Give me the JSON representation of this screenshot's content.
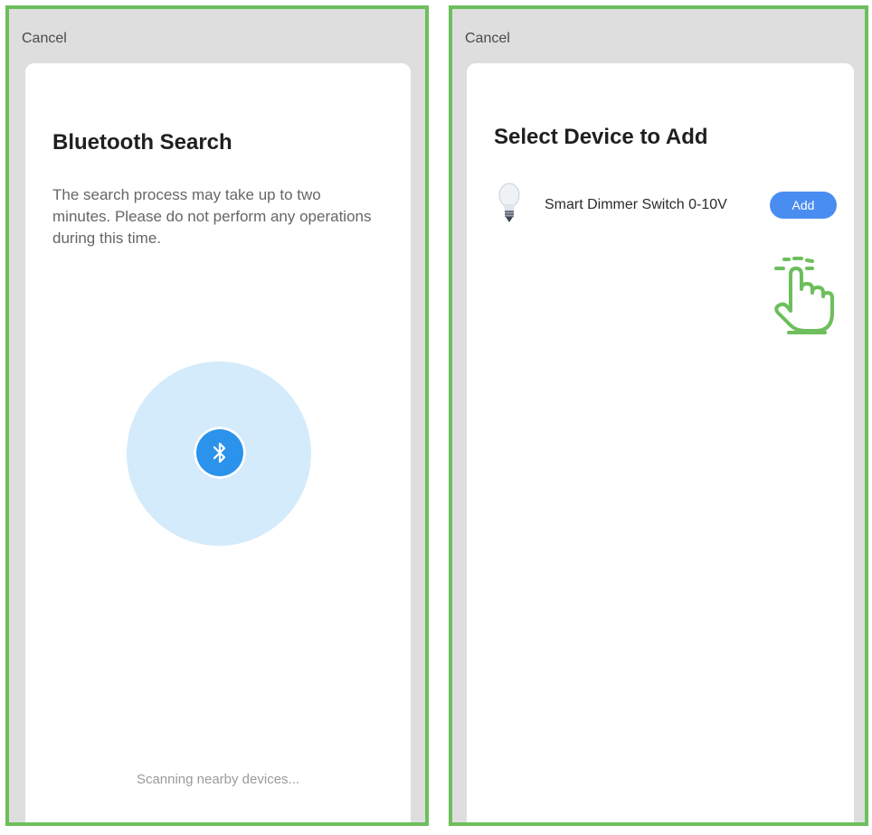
{
  "left_screen": {
    "cancel_label": "Cancel",
    "title": "Bluetooth Search",
    "description": "The search process may take up to two minutes. Please do not perform any operations during this time.",
    "status": "Scanning nearby devices...",
    "icon": "bluetooth-icon"
  },
  "right_screen": {
    "cancel_label": "Cancel",
    "title": "Select Device to Add",
    "devices": [
      {
        "name": "Smart Dimmer Switch 0-10V",
        "icon": "light-bulb-icon",
        "action_label": "Add"
      }
    ],
    "pointer_icon": "tap-hand-icon"
  },
  "colors": {
    "frame_border": "#6cbf5c",
    "background": "#dedede",
    "bluetooth_blue": "#2b93ec",
    "radar_fill": "#d4ebfb",
    "add_button": "#4a8df0",
    "hand_green": "#6cbf5c"
  }
}
